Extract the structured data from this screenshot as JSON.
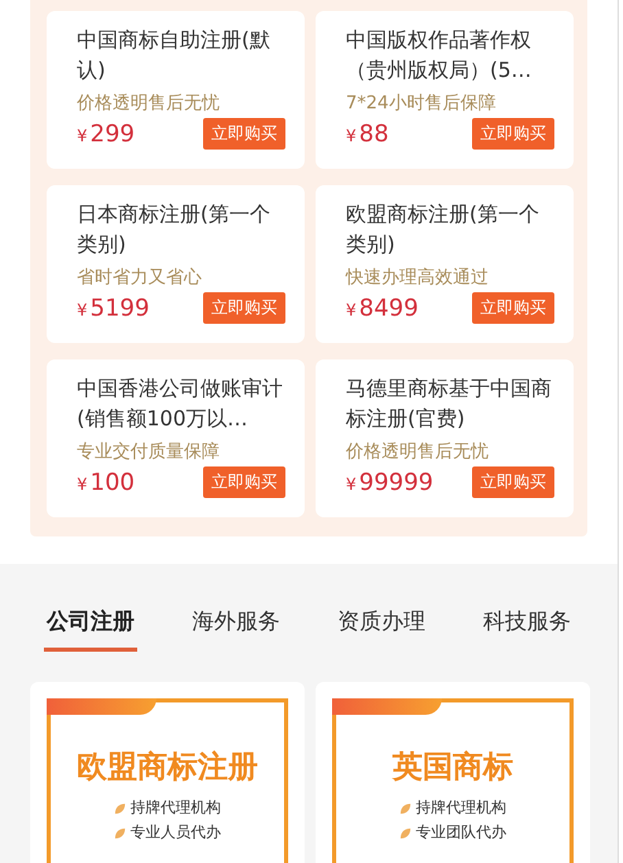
{
  "products": [
    {
      "title": "中国商标自助注册(默认)",
      "tagline": "价格透明售后无忧",
      "currency": "¥",
      "price": "299",
      "button": "立即购买"
    },
    {
      "title": "中国版权作品著作权（贵州版权局）(5…",
      "tagline": "7*24小时售后保障",
      "currency": "¥",
      "price": "88",
      "button": "立即购买"
    },
    {
      "title": "日本商标注册(第一个类别)",
      "tagline": "省时省力又省心",
      "currency": "¥",
      "price": "5199",
      "button": "立即购买"
    },
    {
      "title": "欧盟商标注册(第一个类别)",
      "tagline": "快速办理高效通过",
      "currency": "¥",
      "price": "8499",
      "button": "立即购买"
    },
    {
      "title": "中国香港公司做账审计(销售额100万以…",
      "tagline": "专业交付质量保障",
      "currency": "¥",
      "price": "100",
      "button": "立即购买"
    },
    {
      "title": "马德里商标基于中国商标注册(官费)",
      "tagline": "价格透明售后无忧",
      "currency": "¥",
      "price": "99999",
      "button": "立即购买"
    }
  ],
  "tabs": [
    {
      "label": "公司注册",
      "selected": true
    },
    {
      "label": "海外服务",
      "selected": false
    },
    {
      "label": "资质办理",
      "selected": false
    },
    {
      "label": "科技服务",
      "selected": false
    }
  ],
  "banners": [
    {
      "title": "欧盟商标注册",
      "bullets": [
        "持牌代理机构",
        "专业人员代办"
      ]
    },
    {
      "title": "英国商标",
      "bullets": [
        "持牌代理机构",
        "专业团队代办"
      ]
    }
  ]
}
